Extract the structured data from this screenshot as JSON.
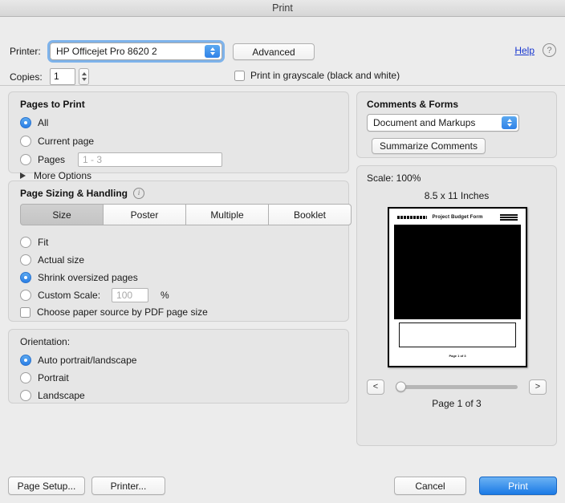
{
  "window": {
    "title": "Print"
  },
  "top": {
    "printer_label": "Printer:",
    "printer_value": "HP Officejet Pro 8620 2",
    "advanced_label": "Advanced",
    "help_label": "Help",
    "help_icon": "question-circle-icon",
    "copies_label": "Copies:",
    "copies_value": "1",
    "grayscale_label": "Print in grayscale (black and white)"
  },
  "pages_to_print": {
    "title": "Pages to Print",
    "options": [
      {
        "label": "All",
        "selected": true
      },
      {
        "label": "Current page",
        "selected": false
      },
      {
        "label": "Pages",
        "selected": false
      }
    ],
    "pages_placeholder": "1 - 3",
    "more_options_label": "More Options"
  },
  "page_sizing": {
    "title": "Page Sizing & Handling",
    "info_icon": "info-icon",
    "tabs": [
      {
        "label": "Size",
        "selected": true
      },
      {
        "label": "Poster",
        "selected": false
      },
      {
        "label": "Multiple",
        "selected": false
      },
      {
        "label": "Booklet",
        "selected": false
      }
    ],
    "options": [
      {
        "label": "Fit",
        "selected": false
      },
      {
        "label": "Actual size",
        "selected": false
      },
      {
        "label": "Shrink oversized pages",
        "selected": true
      },
      {
        "label": "Custom Scale:",
        "selected": false
      }
    ],
    "custom_scale_placeholder": "100",
    "percent_label": "%",
    "paper_source_label": "Choose paper source by PDF page size"
  },
  "orientation": {
    "title": "Orientation:",
    "options": [
      {
        "label": "Auto portrait/landscape",
        "selected": true
      },
      {
        "label": "Portrait",
        "selected": false
      },
      {
        "label": "Landscape",
        "selected": false
      }
    ]
  },
  "comments_forms": {
    "title": "Comments & Forms",
    "selected_option": "Document and Markups",
    "summarize_label": "Summarize Comments"
  },
  "preview": {
    "scale_label": "Scale: 100%",
    "paper_size": "8.5 x 11 Inches",
    "document_title": "Project Budget Form",
    "document_footer": "Page 1 of 3",
    "prev_label": "<",
    "next_label": ">",
    "page_count": "Page 1 of 3"
  },
  "footer": {
    "page_setup_label": "Page Setup...",
    "printer_label": "Printer...",
    "cancel_label": "Cancel",
    "print_label": "Print"
  },
  "colors": {
    "accent": "#2b7fe6",
    "link": "#1736cf",
    "window_bg": "#ececec",
    "group_bg": "#e6e6e6"
  }
}
